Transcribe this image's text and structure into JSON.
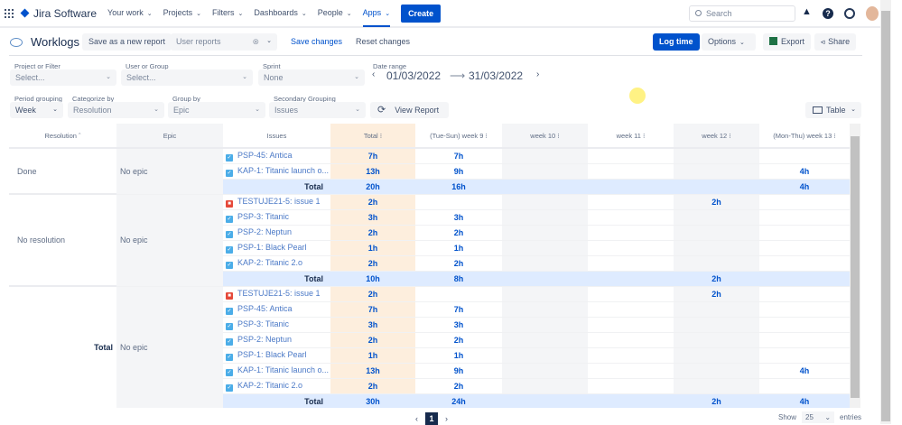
{
  "nav": {
    "brand": "Jira Software",
    "items": [
      "Your work",
      "Projects",
      "Filters",
      "Dashboards",
      "People",
      "Apps"
    ],
    "create": "Create",
    "search_placeholder": "Search",
    "help": "?"
  },
  "toolbar": {
    "title": "Worklogs",
    "save_new": "Save as a new report",
    "user_reports_placeholder": "User reports",
    "save_changes": "Save changes",
    "reset_changes": "Reset changes",
    "log_time": "Log time",
    "options": "Options",
    "export": "Export",
    "share": "Share"
  },
  "filters": {
    "project_label": "Project or Filter",
    "project_value": "Select...",
    "user_label": "User or Group",
    "user_value": "Select...",
    "sprint_label": "Sprint",
    "sprint_value": "None",
    "date_label": "Date range",
    "date_from": "01/03/2022",
    "date_to": "31/03/2022",
    "period_label": "Period grouping",
    "period_value": "Week",
    "categorize_label": "Categorize by",
    "categorize_value": "Resolution",
    "group_label": "Group by",
    "group_value": "Epic",
    "secondary_label": "Secondary Grouping",
    "secondary_value": "Issues",
    "view_report": "View Report",
    "view_mode": "Table"
  },
  "table": {
    "headers": [
      "Resolution",
      "Epic",
      "Issues",
      "Total",
      "(Tue-Sun) week 9",
      "week 10",
      "week 11",
      "week 12",
      "(Mon-Thu) week 13"
    ],
    "total_label": "Total",
    "groups": [
      {
        "resolution": "Done",
        "epic": "No epic",
        "rows": [
          {
            "type": "task",
            "issue": "PSP-45: Antica",
            "values": [
              "7h",
              "7h",
              "",
              "",
              "",
              ""
            ]
          },
          {
            "type": "task",
            "issue": "KAP-1: Titanic launch o...",
            "values": [
              "13h",
              "9h",
              "",
              "",
              "",
              "4h"
            ]
          }
        ],
        "total": [
          "20h",
          "16h",
          "",
          "",
          "",
          "4h"
        ]
      },
      {
        "resolution": "No resolution",
        "epic": "No epic",
        "rows": [
          {
            "type": "bug",
            "issue": "TESTUJE21-5: issue 1",
            "values": [
              "2h",
              "",
              "",
              "",
              "2h",
              ""
            ]
          },
          {
            "type": "task",
            "issue": "PSP-3: Titanic",
            "values": [
              "3h",
              "3h",
              "",
              "",
              "",
              ""
            ]
          },
          {
            "type": "task",
            "issue": "PSP-2: Neptun",
            "values": [
              "2h",
              "2h",
              "",
              "",
              "",
              ""
            ]
          },
          {
            "type": "task",
            "issue": "PSP-1: Black Pearl",
            "values": [
              "1h",
              "1h",
              "",
              "",
              "",
              ""
            ]
          },
          {
            "type": "task",
            "issue": "KAP-2: Titanic 2.o",
            "values": [
              "2h",
              "2h",
              "",
              "",
              "",
              ""
            ]
          }
        ],
        "total": [
          "10h",
          "8h",
          "",
          "",
          "2h",
          ""
        ]
      },
      {
        "resolution": "Total",
        "epic": "No epic",
        "bold": true,
        "rows": [
          {
            "type": "bug",
            "issue": "TESTUJE21-5: issue 1",
            "values": [
              "2h",
              "",
              "",
              "",
              "2h",
              ""
            ]
          },
          {
            "type": "task",
            "issue": "PSP-45: Antica",
            "values": [
              "7h",
              "7h",
              "",
              "",
              "",
              ""
            ]
          },
          {
            "type": "task",
            "issue": "PSP-3: Titanic",
            "values": [
              "3h",
              "3h",
              "",
              "",
              "",
              ""
            ]
          },
          {
            "type": "task",
            "issue": "PSP-2: Neptun",
            "values": [
              "2h",
              "2h",
              "",
              "",
              "",
              ""
            ]
          },
          {
            "type": "task",
            "issue": "PSP-1: Black Pearl",
            "values": [
              "1h",
              "1h",
              "",
              "",
              "",
              ""
            ]
          },
          {
            "type": "task",
            "issue": "KAP-1: Titanic launch o...",
            "values": [
              "13h",
              "9h",
              "",
              "",
              "",
              "4h"
            ]
          },
          {
            "type": "task",
            "issue": "KAP-2: Titanic 2.o",
            "values": [
              "2h",
              "2h",
              "",
              "",
              "",
              ""
            ]
          }
        ],
        "total": [
          "30h",
          "24h",
          "",
          "",
          "2h",
          "4h"
        ]
      }
    ]
  },
  "pagination": {
    "current": "1",
    "show_label": "Show",
    "page_size": "25",
    "entries_label": "entries"
  }
}
